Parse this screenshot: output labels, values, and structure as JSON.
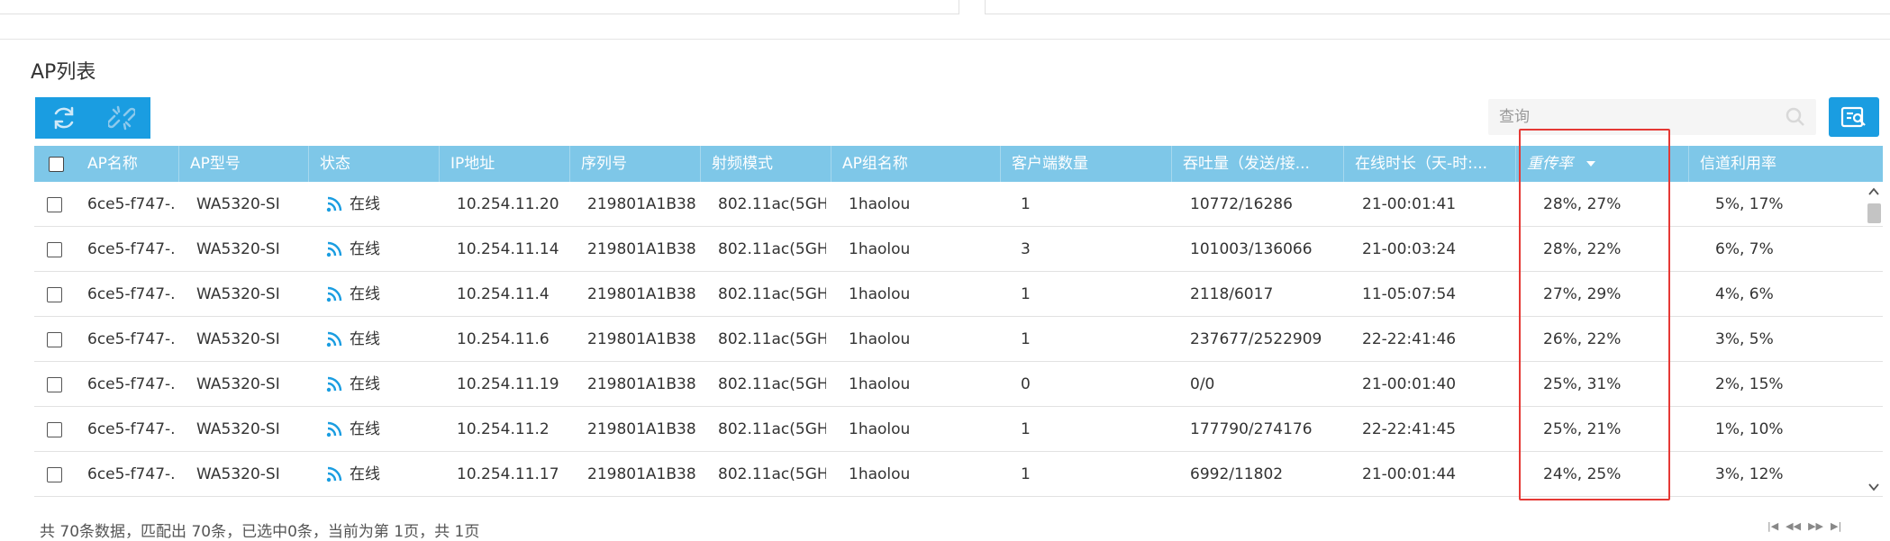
{
  "section_title": "AP列表",
  "toolbar": {
    "refresh_icon": "refresh-icon",
    "unlink_icon": "unlink-icon"
  },
  "search": {
    "placeholder": "查询"
  },
  "table": {
    "columns": [
      "AP名称",
      "AP型号",
      "状态",
      "IP地址",
      "序列号",
      "射频模式",
      "AP组名称",
      "客户端数量",
      "吞吐量（发送/接...",
      "在线时长（天-时:...",
      "重传率",
      "信道利用率"
    ],
    "sorted_column": "重传率",
    "sort_direction": "desc",
    "rows": [
      {
        "name": "6ce5-f747-...",
        "model": "WA5320-SI",
        "status": "在线",
        "ip": "10.254.11.20",
        "serial": "219801A1B38...",
        "radio": "802.11ac(5GH...",
        "group": "1haolou",
        "clients": "1",
        "throughput": "10772/16286",
        "uptime": "21-00:01:41",
        "retrans": "28%, 27%",
        "channel": "5%, 17%"
      },
      {
        "name": "6ce5-f747-...",
        "model": "WA5320-SI",
        "status": "在线",
        "ip": "10.254.11.14",
        "serial": "219801A1B38...",
        "radio": "802.11ac(5GH...",
        "group": "1haolou",
        "clients": "3",
        "throughput": "101003/136066",
        "uptime": "21-00:03:24",
        "retrans": "28%, 22%",
        "channel": "6%, 7%"
      },
      {
        "name": "6ce5-f747-...",
        "model": "WA5320-SI",
        "status": "在线",
        "ip": "10.254.11.4",
        "serial": "219801A1B38...",
        "radio": "802.11ac(5GH...",
        "group": "1haolou",
        "clients": "1",
        "throughput": "2118/6017",
        "uptime": "11-05:07:54",
        "retrans": "27%, 29%",
        "channel": "4%, 6%"
      },
      {
        "name": "6ce5-f747-...",
        "model": "WA5320-SI",
        "status": "在线",
        "ip": "10.254.11.6",
        "serial": "219801A1B38...",
        "radio": "802.11ac(5GH...",
        "group": "1haolou",
        "clients": "1",
        "throughput": "237677/2522909",
        "uptime": "22-22:41:46",
        "retrans": "26%, 22%",
        "channel": "3%, 5%"
      },
      {
        "name": "6ce5-f747-...",
        "model": "WA5320-SI",
        "status": "在线",
        "ip": "10.254.11.19",
        "serial": "219801A1B38...",
        "radio": "802.11ac(5GH...",
        "group": "1haolou",
        "clients": "0",
        "throughput": "0/0",
        "uptime": "21-00:01:40",
        "retrans": "25%, 31%",
        "channel": "2%, 15%"
      },
      {
        "name": "6ce5-f747-...",
        "model": "WA5320-SI",
        "status": "在线",
        "ip": "10.254.11.2",
        "serial": "219801A1B38...",
        "radio": "802.11ac(5GH...",
        "group": "1haolou",
        "clients": "1",
        "throughput": "177790/274176",
        "uptime": "22-22:41:45",
        "retrans": "25%, 21%",
        "channel": "1%, 10%"
      },
      {
        "name": "6ce5-f747-...",
        "model": "WA5320-SI",
        "status": "在线",
        "ip": "10.254.11.17",
        "serial": "219801A1B38...",
        "radio": "802.11ac(5GH...",
        "group": "1haolou",
        "clients": "1",
        "throughput": "6992/11802",
        "uptime": "21-00:01:44",
        "retrans": "24%, 25%",
        "channel": "3%, 12%"
      }
    ]
  },
  "footer": {
    "summary": "共 70条数据，匹配出 70条，已选中0条，当前为第 1页，共 1页"
  },
  "pager": {
    "first": "|◀",
    "prev": "◀◀",
    "next": "▶▶",
    "last": "▶|"
  },
  "colors": {
    "accent": "#1a9de1",
    "header": "#7ec7e8",
    "highlight": "#e53935",
    "status_icon": "#1a9de1"
  }
}
